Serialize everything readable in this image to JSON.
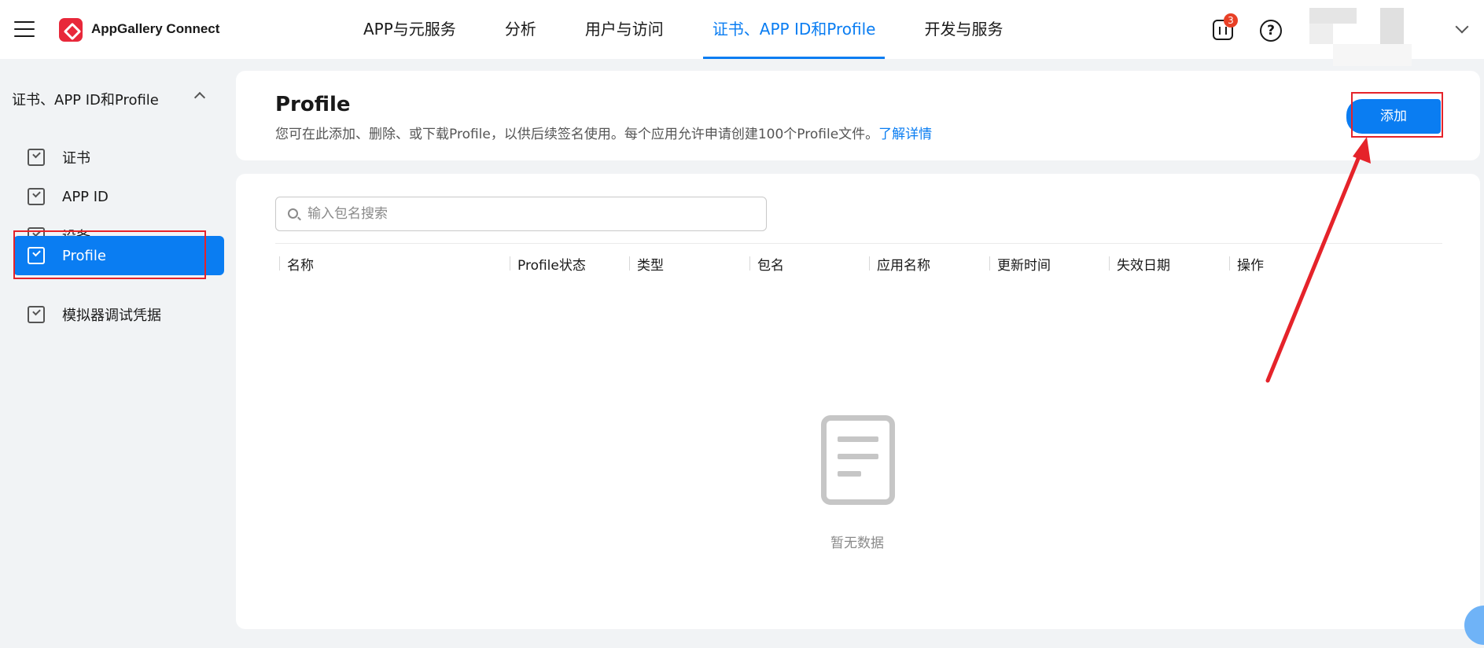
{
  "brand": {
    "name": "AppGallery Connect"
  },
  "topnav": {
    "items": [
      {
        "label": "APP与元服务"
      },
      {
        "label": "分析"
      },
      {
        "label": "用户与访问"
      },
      {
        "label": "证书、APP ID和Profile"
      },
      {
        "label": "开发与服务"
      }
    ],
    "active_index": 3
  },
  "header_icons": {
    "notification_count": "3",
    "help_glyph": "?"
  },
  "sidebar": {
    "group_label": "证书、APP ID和Profile",
    "items": [
      {
        "label": "证书"
      },
      {
        "label": "APP ID"
      },
      {
        "label": "设备"
      },
      {
        "label": "Profile"
      },
      {
        "label": "模拟器调试凭据"
      }
    ],
    "active_index": 3
  },
  "page": {
    "title": "Profile",
    "description": "您可在此添加、删除、或下载Profile，以供后续签名使用。每个应用允许申请创建100个Profile文件。",
    "learn_more": "了解详情",
    "add_button": "添加"
  },
  "search": {
    "placeholder": "输入包名搜索",
    "value": ""
  },
  "table": {
    "columns": [
      "名称",
      "Profile状态",
      "类型",
      "包名",
      "应用名称",
      "更新时间",
      "失效日期",
      "操作"
    ],
    "rows": []
  },
  "empty_state": {
    "text": "暂无数据"
  },
  "colors": {
    "accent": "#0a7df2",
    "annotation": "#e5232a",
    "badge": "#e84026"
  }
}
